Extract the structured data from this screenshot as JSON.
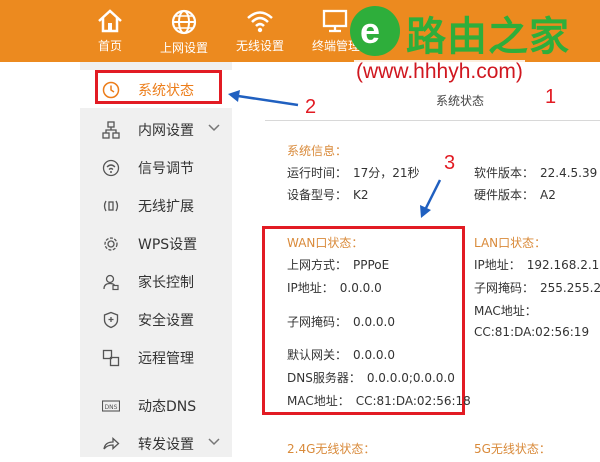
{
  "topnav": {
    "items": [
      {
        "label": "首页"
      },
      {
        "label": "上网设置"
      },
      {
        "label": "无线设置"
      },
      {
        "label": "终端管理"
      }
    ]
  },
  "watermark": {
    "brand": "路由之家",
    "url": "(www.hhhyh.com)"
  },
  "sidebar": {
    "items": [
      {
        "label": "系统状态"
      },
      {
        "label": "内网设置"
      },
      {
        "label": "信号调节"
      },
      {
        "label": "无线扩展"
      },
      {
        "label": "WPS设置"
      },
      {
        "label": "家长控制"
      },
      {
        "label": "安全设置"
      },
      {
        "label": "远程管理"
      },
      {
        "label": "动态DNS"
      },
      {
        "label": "转发设置"
      }
    ]
  },
  "annotations": {
    "one": "1",
    "two": "2",
    "three": "3"
  },
  "page": {
    "title": "系统状态"
  },
  "system_info": {
    "title": "系统信息：",
    "uptime_label": "运行时间：",
    "uptime_value": "17分，21秒",
    "model_label": "设备型号：",
    "model_value": "K2",
    "sw_label": "软件版本：",
    "sw_value": "22.4.5.39",
    "hw_label": "硬件版本：",
    "hw_value": "A2"
  },
  "wan": {
    "title": "WAN口状态：",
    "mode_label": "上网方式：",
    "mode_value": "PPPoE",
    "ip_label": "IP地址：",
    "ip_value": "0.0.0.0",
    "mask_label": "子网掩码：",
    "mask_value": "0.0.0.0",
    "gw_label": "默认网关：",
    "gw_value": "0.0.0.0",
    "dns_label": "DNS服务器：",
    "dns_value": "0.0.0.0;0.0.0.0",
    "mac_label": "MAC地址：",
    "mac_value": "CC:81:DA:02:56:18"
  },
  "lan": {
    "title": "LAN口状态：",
    "ip_label": "IP地址：",
    "ip_value": "192.168.2.1",
    "mask_label": "子网掩码：",
    "mask_value": "255.255.25",
    "mac_label": "MAC地址：",
    "mac_value": "CC:81:DA:02:56:19"
  },
  "wireless": {
    "w24_title": "2.4G无线状态：",
    "w5_title": "5G无线状态："
  },
  "colors": {
    "topbar": "#ec8a1f",
    "accent": "#ec7d1a",
    "highlight": "#e21b23",
    "watermark_green": "#2eae3b",
    "arrow_blue": "#2060c0"
  }
}
